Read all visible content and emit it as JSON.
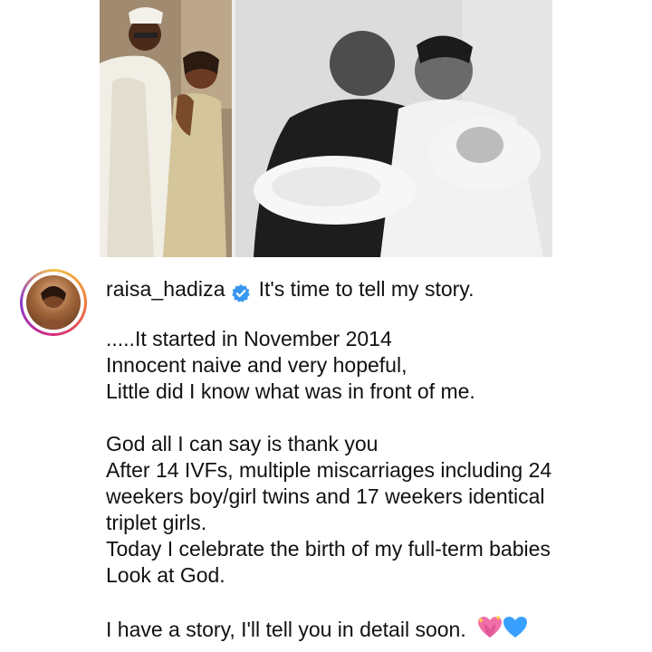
{
  "post": {
    "username": "raisa_hadiza",
    "verified": true,
    "first_line": "It's time to tell my story.",
    "lines": [
      ".....It started in November 2014",
      "Innocent naive and very hopeful,",
      "Little did I know what was in front of me.",
      "",
      "God all I can say is thank you",
      "After 14 IVFs, multiple miscarriages including 24",
      "weekers boy/girl twins and 17 weekers identical",
      "triplet girls.",
      "Today I celebrate the birth of my full-term babies",
      "Look at God.",
      ""
    ],
    "last_line": "I have a story, I'll tell you in detail soon.",
    "emoji": [
      "sparkling-heart-icon",
      "blue-heart-icon"
    ]
  },
  "images": {
    "left": "couple-photo",
    "right": "couple-with-newborns-photo"
  },
  "colors": {
    "verified": "#3897f0",
    "ring": [
      "#f5c24b",
      "#f07b3a",
      "#d6297b",
      "#8b39c9"
    ],
    "pink_heart": "#f06fa8",
    "blue_heart": "#3aa0ff"
  }
}
